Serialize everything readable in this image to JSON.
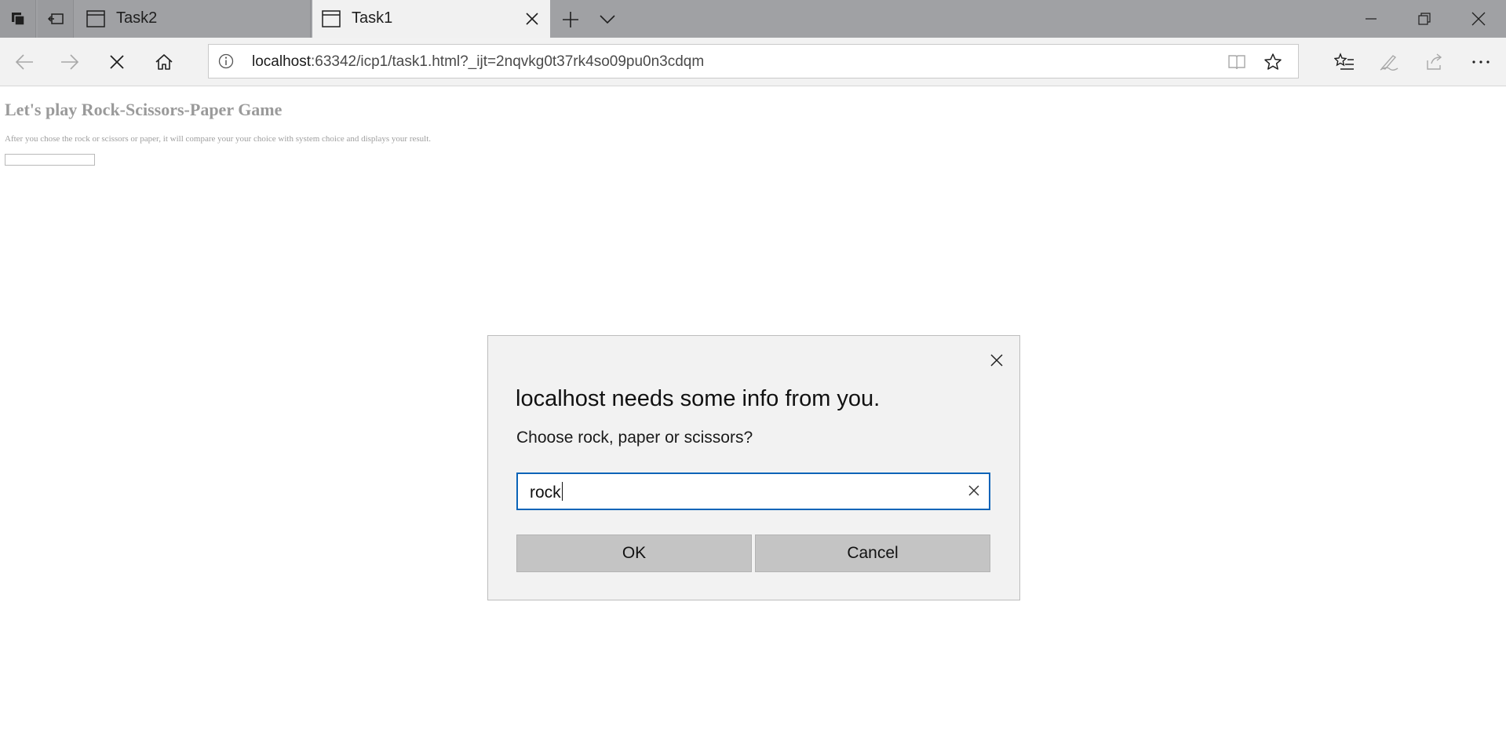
{
  "browser": {
    "tabs": [
      {
        "title": "Task2",
        "active": false
      },
      {
        "title": "Task1",
        "active": true
      }
    ],
    "address": {
      "host": "localhost",
      "path": ":63342/icp1/task1.html?_ijt=2nqvkg0t37rk4so09pu0n3cdqm"
    }
  },
  "page": {
    "heading": "Let's play Rock-Scissors-Paper Game",
    "description": "After you chose the rock or scissors or paper, it will compare your your choice with system choice and displays your result."
  },
  "dialog": {
    "title": "localhost needs some info from you.",
    "message": "Choose rock, paper or scissors?",
    "input_value": "rock",
    "ok_label": "OK",
    "cancel_label": "Cancel"
  },
  "colors": {
    "tabbar_bg": "#a0a1a4",
    "active_tab_bg": "#f1f1f1",
    "input_focus_border": "#0a64b8",
    "dialog_bg": "#f2f2f2",
    "button_bg": "#c4c4c4"
  }
}
